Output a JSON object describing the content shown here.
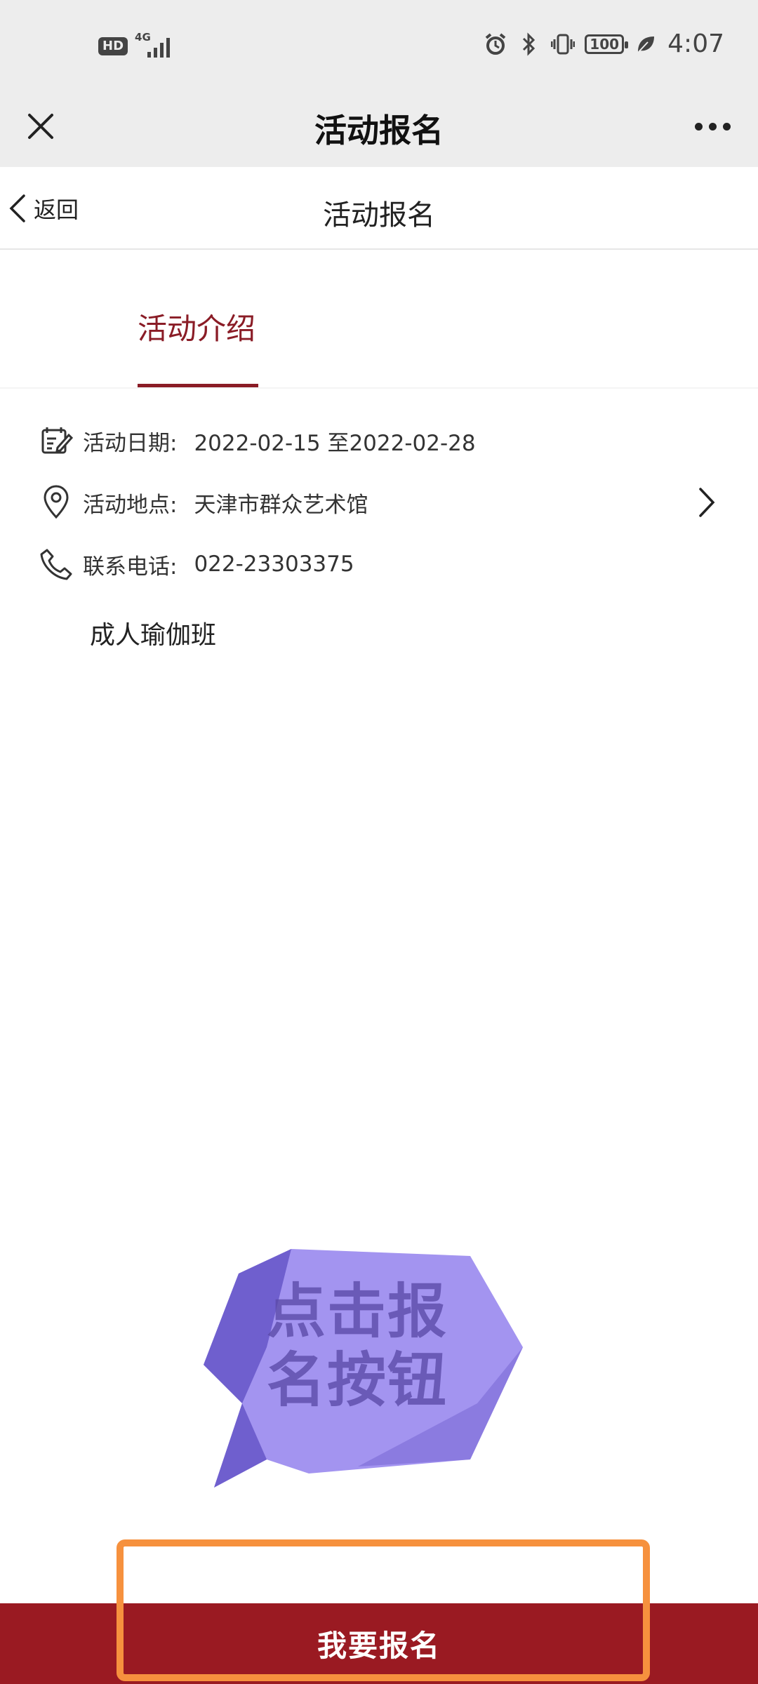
{
  "status_bar": {
    "hd_badge": "HD",
    "network_label": "4G",
    "battery_level": "100",
    "time": "4:07",
    "icons": [
      "alarm-icon",
      "bluetooth-icon",
      "vibrate-icon",
      "battery-icon",
      "leaf-icon"
    ]
  },
  "app_header": {
    "title": "活动报名",
    "close_icon": "close-icon",
    "more_icon": "more-icon"
  },
  "page_nav": {
    "back_label": "返回",
    "title": "活动报名"
  },
  "tabs": [
    {
      "label": "活动介绍",
      "active": true
    }
  ],
  "details": {
    "date": {
      "label": "活动日期:",
      "value": "2022-02-15 至2022-02-28",
      "icon": "calendar-edit-icon"
    },
    "location": {
      "label": "活动地点:",
      "value": "天津市群众艺术馆",
      "icon": "location-pin-icon"
    },
    "phone": {
      "label": "联系电话:",
      "value": "022-23303375",
      "icon": "phone-icon"
    }
  },
  "description": "成人瑜伽班",
  "overlay_hint": {
    "line1": "点击报",
    "line2": "名按钮"
  },
  "signup_button": {
    "label": "我要报名"
  },
  "colors": {
    "accent": "#8a1c26",
    "button_bg": "#9a1a22",
    "highlight_border": "#f6913e",
    "bubble_light": "#a394f0",
    "bubble_dark": "#6f5fce",
    "header_bg": "#ededed"
  }
}
